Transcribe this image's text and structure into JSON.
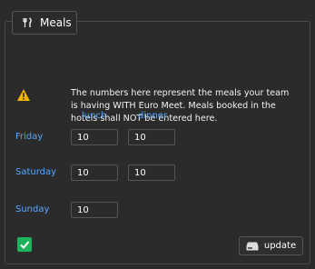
{
  "header": {
    "tab_label": "Meals",
    "tab_icon": "fork-knife-icon"
  },
  "notice": {
    "icon": "warning-icon",
    "text": "The numbers here represent the meals your team is having WITH Euro Meet. Meals booked in the hotels shall NOT be entered here."
  },
  "columns": {
    "lunch": "lunch",
    "dinner": "dinner"
  },
  "rows": [
    {
      "day": "Friday",
      "lunch": "10",
      "dinner": "10"
    },
    {
      "day": "Saturday",
      "lunch": "10",
      "dinner": "10"
    },
    {
      "day": "Sunday",
      "lunch": "10"
    }
  ],
  "footer": {
    "check_icon": "checkmark-icon",
    "update_label": "update",
    "update_icon": "server-icon"
  },
  "colors": {
    "accent": "#57a6ff",
    "success": "#1cb35a",
    "warning": "#f5b301",
    "background": "#2b2b2b"
  }
}
